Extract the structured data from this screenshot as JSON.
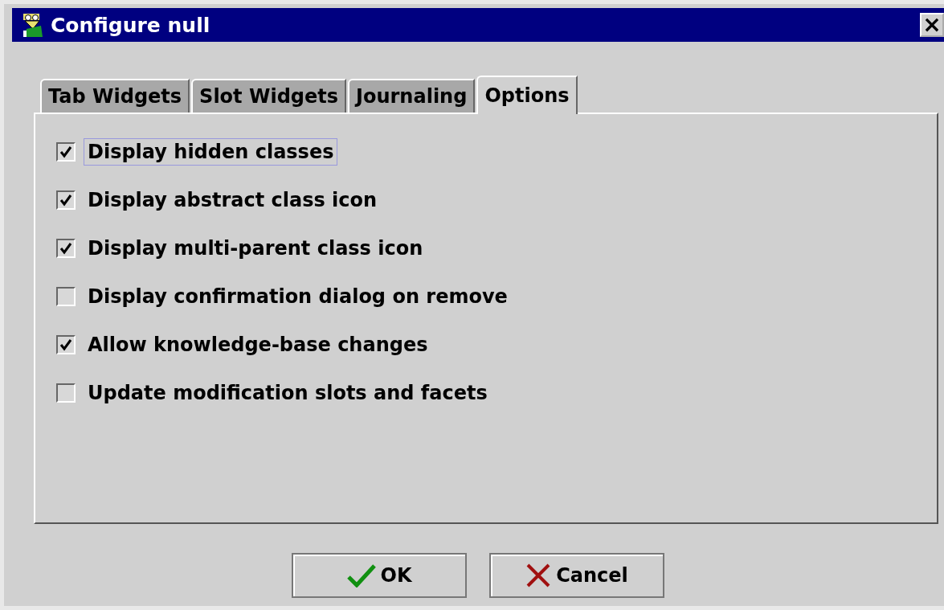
{
  "window": {
    "title": "Configure null",
    "close": "×"
  },
  "tabs": [
    {
      "label": "Tab Widgets",
      "selected": false
    },
    {
      "label": "Slot Widgets",
      "selected": false
    },
    {
      "label": "Journaling",
      "selected": false
    },
    {
      "label": "Options",
      "selected": true
    }
  ],
  "options": [
    {
      "label": "Display hidden classes",
      "checked": true,
      "focused": true
    },
    {
      "label": "Display abstract class icon",
      "checked": true,
      "focused": false
    },
    {
      "label": "Display multi-parent class icon",
      "checked": true,
      "focused": false
    },
    {
      "label": "Display confirmation dialog on remove",
      "checked": false,
      "focused": false
    },
    {
      "label": "Allow knowledge-base changes",
      "checked": true,
      "focused": false
    },
    {
      "label": "Update modification slots and facets",
      "checked": false,
      "focused": false
    }
  ],
  "buttons": [
    {
      "label": "OK",
      "kind": "ok"
    },
    {
      "label": "Cancel",
      "kind": "cancel"
    }
  ]
}
